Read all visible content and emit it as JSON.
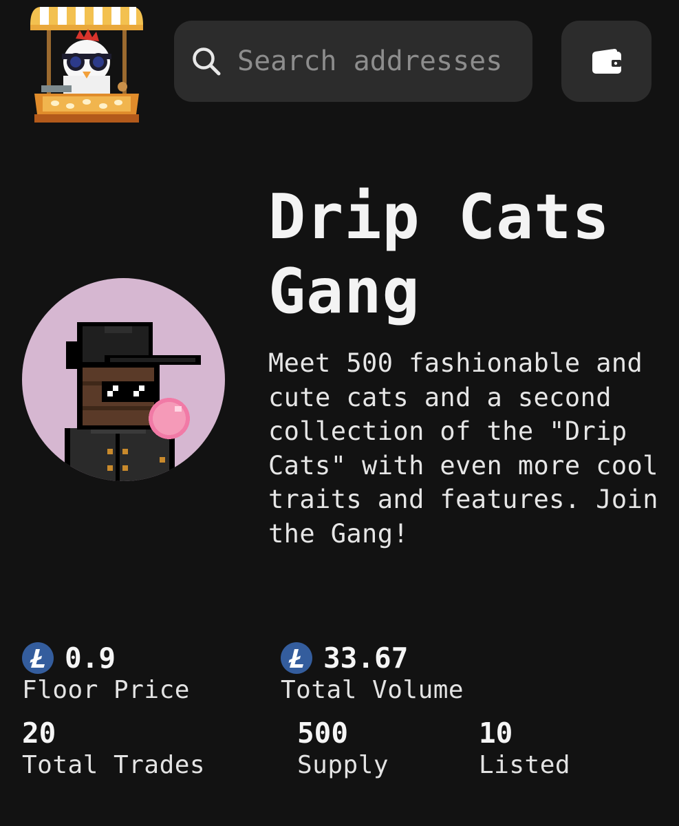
{
  "header": {
    "search": {
      "placeholder": "Search addresses",
      "value": ""
    },
    "logo_icon": "market-stall-chicken-logo",
    "wallet_icon": "wallet-icon"
  },
  "collection": {
    "name": "Drip Cats Gang",
    "description": "Meet 500 fashionable and cute cats and a second collection of the \"Drip Cats\" with even more cool traits and features. Join the Gang!",
    "avatar_icon": "pixel-cat-with-cap-sunglasses-bubblegum"
  },
  "stats": {
    "floor_price": {
      "value": "0.9",
      "label": "Floor Price",
      "currency_icon": "litecoin-icon"
    },
    "total_volume": {
      "value": "33.67",
      "label": "Total Volume",
      "currency_icon": "litecoin-icon"
    },
    "total_trades": {
      "value": "20",
      "label": "Total Trades"
    },
    "supply": {
      "value": "500",
      "label": "Supply"
    },
    "listed": {
      "value": "10",
      "label": "Listed"
    }
  },
  "colors": {
    "background": "#121212",
    "surface": "#2c2c2c",
    "litecoin": "#345d9d",
    "avatar_bg": "#d6b7d1"
  }
}
